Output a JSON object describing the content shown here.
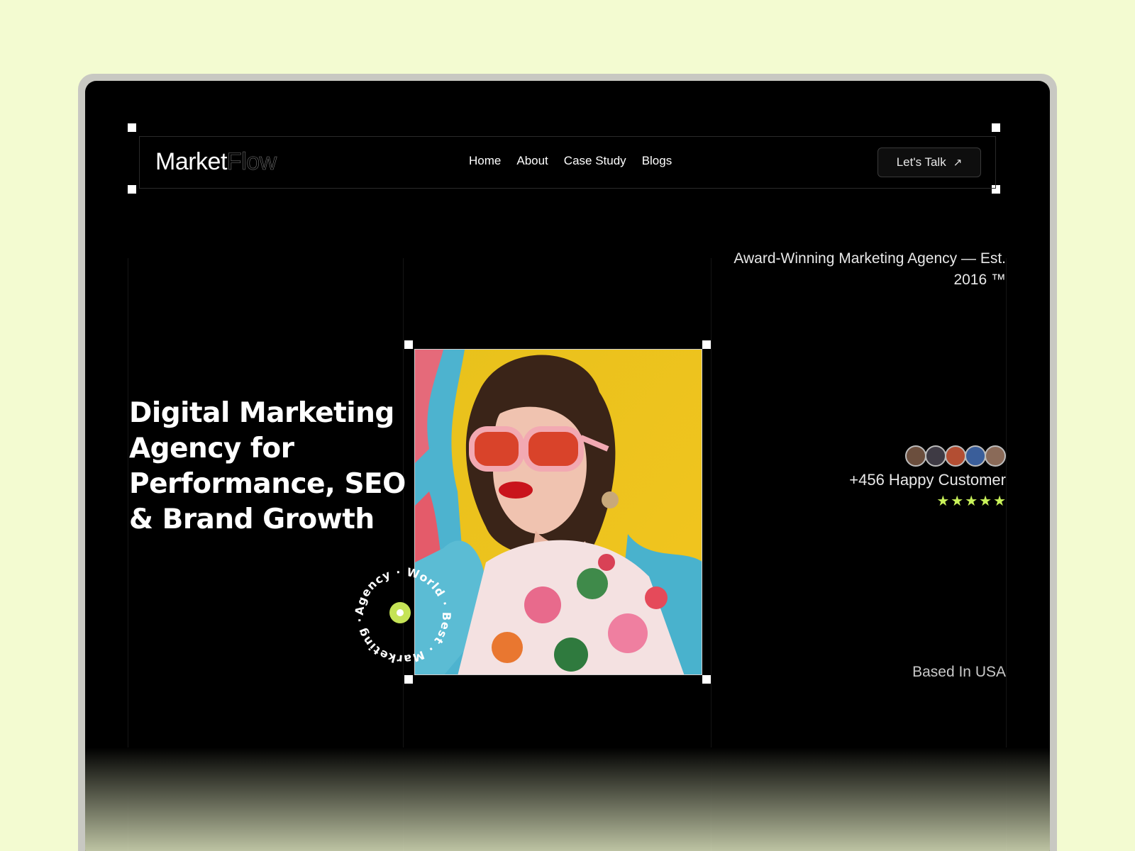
{
  "logo": {
    "primary": "Market",
    "secondary": "Flow"
  },
  "nav": {
    "items": [
      {
        "label": "Home"
      },
      {
        "label": "About"
      },
      {
        "label": "Case Study"
      },
      {
        "label": "Blogs"
      }
    ],
    "cta_label": "Let's Talk",
    "cta_icon": "arrow-up-right-icon"
  },
  "hero": {
    "tagline": "Award-Winning Marketing Agency — Est. 2016 ™",
    "headline": "Digital Marketing Agency for Performance, SEO & Brand Growth",
    "badge_text": "Agency · World · Best · Marketing ·",
    "customers_label": "+456 Happy Customer",
    "rating_stars": 5,
    "stars_text": "★★★★★",
    "location": "Based In USA"
  },
  "colors": {
    "background": "#f3fbd1",
    "screen": "#000000",
    "accent": "#c9f25a",
    "text": "#ffffff"
  }
}
